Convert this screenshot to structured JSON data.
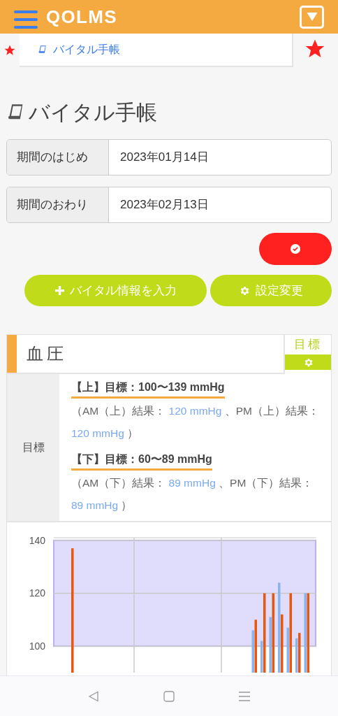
{
  "header": {
    "logo": "QOLMS"
  },
  "breadcrumb": {
    "label": "バイタル手帳"
  },
  "page_title": "バイタル手帳",
  "period": [
    {
      "label": "期間のはじめ",
      "value": "2023年01月14日"
    },
    {
      "label": "期間のおわり",
      "value": "2023年02月13日"
    }
  ],
  "actions": [
    {
      "label": "バイタル情報を入力",
      "kind": "add"
    },
    {
      "label": "設定変更",
      "kind": "settings"
    }
  ],
  "card": {
    "title": "血圧",
    "target_tab": "目標",
    "row_label": "目標",
    "targets": [
      {
        "heading": "【上】目標：100〜139 mmHg",
        "result": [
          {
            "kind": "plain",
            "text": "（AM（上）結果： "
          },
          {
            "kind": "value",
            "text": "120 mmHg"
          },
          {
            "kind": "plain",
            "text": " 、PM（上）結果： "
          },
          {
            "kind": "value",
            "text": "120 mmHg"
          },
          {
            "kind": "plain",
            "text": " ）"
          }
        ]
      },
      {
        "heading": "【下】目標：60〜89 mmHg",
        "result": [
          {
            "kind": "plain",
            "text": "（AM（下）結果： "
          },
          {
            "kind": "value",
            "text": "89 mmHg"
          },
          {
            "kind": "plain",
            "text": " 、PM（下）結果： "
          },
          {
            "kind": "value",
            "text": "89 mmHg"
          },
          {
            "kind": "plain",
            "text": " ）"
          }
        ]
      }
    ],
    "chart": {
      "axis_labels": [
        "140",
        "120",
        "100"
      ]
    }
  }
}
